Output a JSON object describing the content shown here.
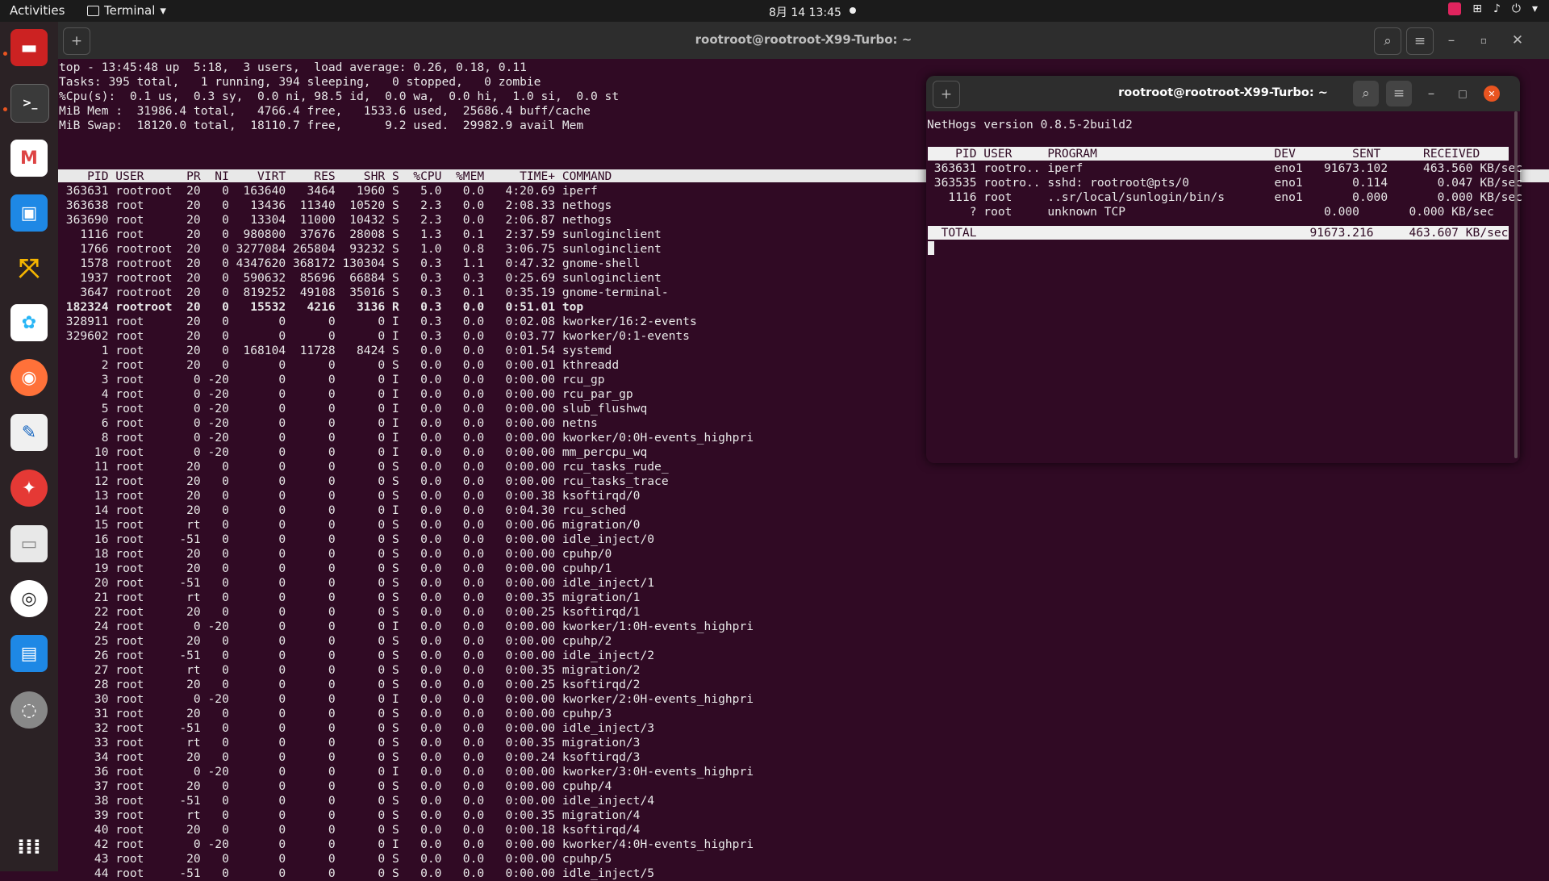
{
  "topbar": {
    "activities": "Activities",
    "app_name": "Terminal",
    "app_menu_arrow": "▾",
    "clock": "8月 14  13:45"
  },
  "dock": {
    "icons": [
      "terminal-red-icon",
      "terminal-icon",
      "gmail-icon",
      "remote-desktop-icon",
      "app-arrows-icon",
      "baidu-netdisk-icon",
      "firefox-icon",
      "text-editor-icon",
      "app-red-icon",
      "files-icon",
      "rhythmbox-icon",
      "libreoffice-writer-icon",
      "disk-icon",
      "show-apps-icon"
    ]
  },
  "main_window": {
    "title": "rootroot@rootroot-X99-Turbo: ~",
    "summary": [
      "top - 13:45:48 up  5:18,  3 users,  load average: 0.26, 0.18, 0.11",
      "Tasks: 395 total,   1 running, 394 sleeping,   0 stopped,   0 zombie",
      "%Cpu(s):  0.1 us,  0.3 sy,  0.0 ni, 98.5 id,  0.0 wa,  0.0 hi,  1.0 si,  0.0 st",
      "MiB Mem :  31986.4 total,   4766.4 free,   1533.6 used,  25686.4 buff/cache",
      "MiB Swap:  18120.0 total,  18110.7 free,      9.2 used.  29982.9 avail Mem"
    ],
    "header": "    PID USER      PR  NI    VIRT    RES    SHR S  %CPU  %MEM     TIME+ COMMAND",
    "rows": [
      " 363631 rootroot  20   0  163640   3464   1960 S   5.0   0.0   4:20.69 iperf",
      " 363638 root      20   0   13436  11340  10520 S   2.3   0.0   2:08.33 nethogs",
      " 363690 root      20   0   13304  11000  10432 S   2.3   0.0   2:06.87 nethogs",
      "   1116 root      20   0  980800  37676  28008 S   1.3   0.1   2:37.59 sunloginclient",
      "   1766 rootroot  20   0 3277084 265804  93232 S   1.0   0.8   3:06.75 sunloginclient",
      "   1578 rootroot  20   0 4347620 368172 130304 S   0.3   1.1   0:47.32 gnome-shell",
      "   1937 rootroot  20   0  590632  85696  66884 S   0.3   0.3   0:25.69 sunloginclient",
      "   3647 rootroot  20   0  819252  49108  35016 S   0.3   0.1   0:35.19 gnome-terminal-",
      " 182324 rootroot  20   0   15532   4216   3136 R   0.3   0.0   0:51.01 top",
      " 328911 root      20   0       0      0      0 I   0.3   0.0   0:02.08 kworker/16:2-events",
      " 329602 root      20   0       0      0      0 I   0.3   0.0   0:03.77 kworker/0:1-events",
      "      1 root      20   0  168104  11728   8424 S   0.0   0.0   0:01.54 systemd",
      "      2 root      20   0       0      0      0 S   0.0   0.0   0:00.01 kthreadd",
      "      3 root       0 -20       0      0      0 I   0.0   0.0   0:00.00 rcu_gp",
      "      4 root       0 -20       0      0      0 I   0.0   0.0   0:00.00 rcu_par_gp",
      "      5 root       0 -20       0      0      0 I   0.0   0.0   0:00.00 slub_flushwq",
      "      6 root       0 -20       0      0      0 I   0.0   0.0   0:00.00 netns",
      "      8 root       0 -20       0      0      0 I   0.0   0.0   0:00.00 kworker/0:0H-events_highpri",
      "     10 root       0 -20       0      0      0 I   0.0   0.0   0:00.00 mm_percpu_wq",
      "     11 root      20   0       0      0      0 S   0.0   0.0   0:00.00 rcu_tasks_rude_",
      "     12 root      20   0       0      0      0 S   0.0   0.0   0:00.00 rcu_tasks_trace",
      "     13 root      20   0       0      0      0 S   0.0   0.0   0:00.38 ksoftirqd/0",
      "     14 root      20   0       0      0      0 I   0.0   0.0   0:04.30 rcu_sched",
      "     15 root      rt   0       0      0      0 S   0.0   0.0   0:00.06 migration/0",
      "     16 root     -51   0       0      0      0 S   0.0   0.0   0:00.00 idle_inject/0",
      "     18 root      20   0       0      0      0 S   0.0   0.0   0:00.00 cpuhp/0",
      "     19 root      20   0       0      0      0 S   0.0   0.0   0:00.00 cpuhp/1",
      "     20 root     -51   0       0      0      0 S   0.0   0.0   0:00.00 idle_inject/1",
      "     21 root      rt   0       0      0      0 S   0.0   0.0   0:00.35 migration/1",
      "     22 root      20   0       0      0      0 S   0.0   0.0   0:00.25 ksoftirqd/1",
      "     24 root       0 -20       0      0      0 I   0.0   0.0   0:00.00 kworker/1:0H-events_highpri",
      "     25 root      20   0       0      0      0 S   0.0   0.0   0:00.00 cpuhp/2",
      "     26 root     -51   0       0      0      0 S   0.0   0.0   0:00.00 idle_inject/2",
      "     27 root      rt   0       0      0      0 S   0.0   0.0   0:00.35 migration/2",
      "     28 root      20   0       0      0      0 S   0.0   0.0   0:00.25 ksoftirqd/2",
      "     30 root       0 -20       0      0      0 I   0.0   0.0   0:00.00 kworker/2:0H-events_highpri",
      "     31 root      20   0       0      0      0 S   0.0   0.0   0:00.00 cpuhp/3",
      "     32 root     -51   0       0      0      0 S   0.0   0.0   0:00.00 idle_inject/3",
      "     33 root      rt   0       0      0      0 S   0.0   0.0   0:00.35 migration/3",
      "     34 root      20   0       0      0      0 S   0.0   0.0   0:00.24 ksoftirqd/3",
      "     36 root       0 -20       0      0      0 I   0.0   0.0   0:00.00 kworker/3:0H-events_highpri",
      "     37 root      20   0       0      0      0 S   0.0   0.0   0:00.00 cpuhp/4",
      "     38 root     -51   0       0      0      0 S   0.0   0.0   0:00.00 idle_inject/4",
      "     39 root      rt   0       0      0      0 S   0.0   0.0   0:00.35 migration/4",
      "     40 root      20   0       0      0      0 S   0.0   0.0   0:00.18 ksoftirqd/4",
      "     42 root       0 -20       0      0      0 I   0.0   0.0   0:00.00 kworker/4:0H-events_highpri",
      "     43 root      20   0       0      0      0 S   0.0   0.0   0:00.00 cpuhp/5",
      "     44 root     -51   0       0      0      0 S   0.0   0.0   0:00.00 idle_inject/5"
    ]
  },
  "nethogs_window": {
    "title": "rootroot@rootroot-X99-Turbo: ~",
    "version": "NetHogs version 0.8.5-2build2",
    "header": "    PID USER     PROGRAM                         DEV        SENT      RECEIVED       ",
    "rows": [
      " 363631 rootro.. iperf                           eno1   91673.102     463.560 KB/sec",
      " 363535 rootro.. sshd: rootroot@pts/0            eno1       0.114       0.047 KB/sec",
      "   1116 root     ..sr/local/sunlogin/bin/s       eno1       0.000       0.000 KB/sec",
      "      ? root     unknown TCP                            0.000       0.000 KB/sec"
    ],
    "total": "  TOTAL                                               91673.216     463.607 KB/sec "
  }
}
